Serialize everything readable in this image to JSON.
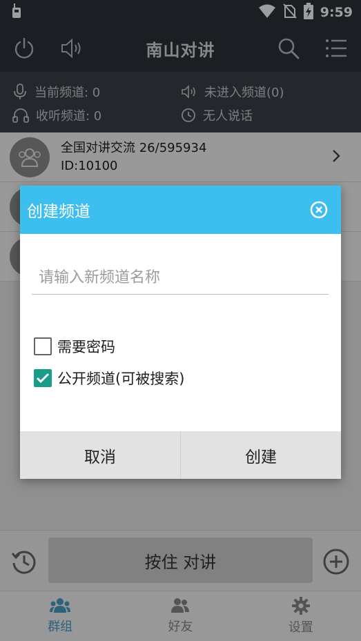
{
  "status_bar": {
    "time": "9:59"
  },
  "header": {
    "title": "南山对讲"
  },
  "info": {
    "current_channel": "当前频道: 0",
    "listen_channel": "收听频道: 0",
    "channel_state": "未进入频道(0)",
    "talk_state": "无人说话"
  },
  "channels": [
    {
      "title": "全国对讲交流 26/595934",
      "id": "ID:10100"
    }
  ],
  "ptt": {
    "label": "按住 对讲"
  },
  "nav": {
    "tabs": [
      {
        "label": "群组"
      },
      {
        "label": "好友"
      },
      {
        "label": "设置"
      }
    ]
  },
  "dialog": {
    "title": "创建频道",
    "input_placeholder": "请输入新频道名称",
    "option_password": "需要密码",
    "option_public": "公开频道(可被搜索)",
    "cancel": "取消",
    "create": "创建"
  },
  "colors": {
    "dialog_header": "#3cbfee",
    "checkbox_checked": "#199c8a",
    "nav_active": "#4a9ec9",
    "app_bar": "#2c323a"
  }
}
